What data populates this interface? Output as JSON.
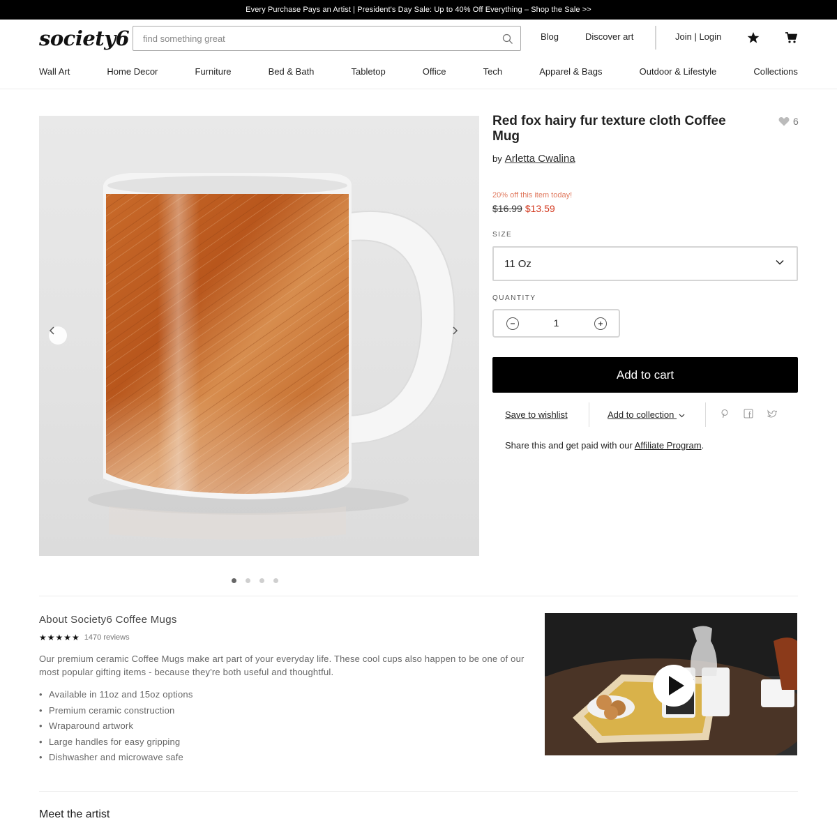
{
  "banner": {
    "text": "Every Purchase Pays an Artist | President's Day Sale: Up to 40% Off Everything – Shop the Sale >>"
  },
  "header": {
    "logo": "society6",
    "search_placeholder": "find something great",
    "links": {
      "blog": "Blog",
      "discover": "Discover art",
      "join_login": "Join | Login"
    }
  },
  "nav": {
    "items": [
      "Wall Art",
      "Home Decor",
      "Furniture",
      "Bed & Bath",
      "Tabletop",
      "Office",
      "Tech",
      "Apparel & Bags",
      "Outdoor & Lifestyle",
      "Collections"
    ]
  },
  "product": {
    "title": "Red fox hairy fur texture cloth Coffee Mug",
    "by_label": "by",
    "artist": "Arletta Cwalina",
    "likes": "6",
    "promo": "20% off this item today!",
    "price_original": "$16.99",
    "price_sale": "$13.59",
    "size_label": "SIZE",
    "size_value": "11 Oz",
    "quantity_label": "QUANTITY",
    "quantity_value": "1",
    "add_to_cart": "Add to cart",
    "save_wishlist": "Save to wishlist",
    "add_collection": "Add to collection",
    "affiliate_prefix": "Share this and get paid with our ",
    "affiliate_link": "Affiliate Program",
    "affiliate_suffix": ".",
    "gallery": {
      "image_count": 4,
      "active_index": 0
    }
  },
  "about": {
    "title": "About Society6 Coffee Mugs",
    "stars": "★★★★★",
    "rating_value": 5,
    "reviews": "1470 reviews",
    "description": "Our premium ceramic Coffee Mugs make art part of your everyday life. These cool cups also happen to be one of our most popular gifting items - because they're both useful and thoughtful.",
    "features": [
      "Available in 11oz and 15oz options",
      "Premium ceramic construction",
      "Wraparound artwork",
      "Large handles for easy gripping",
      "Dishwasher and microwave safe"
    ]
  },
  "artist_section": {
    "title": "Meet the artist"
  },
  "colors": {
    "sale_red": "#d2361c",
    "promo_orange": "#e07a5f",
    "cta_black": "#000000"
  },
  "icons": {
    "search": "search-icon",
    "wishlist": "star-icon",
    "cart": "cart-icon",
    "like": "heart-icon",
    "play": "play-icon"
  }
}
